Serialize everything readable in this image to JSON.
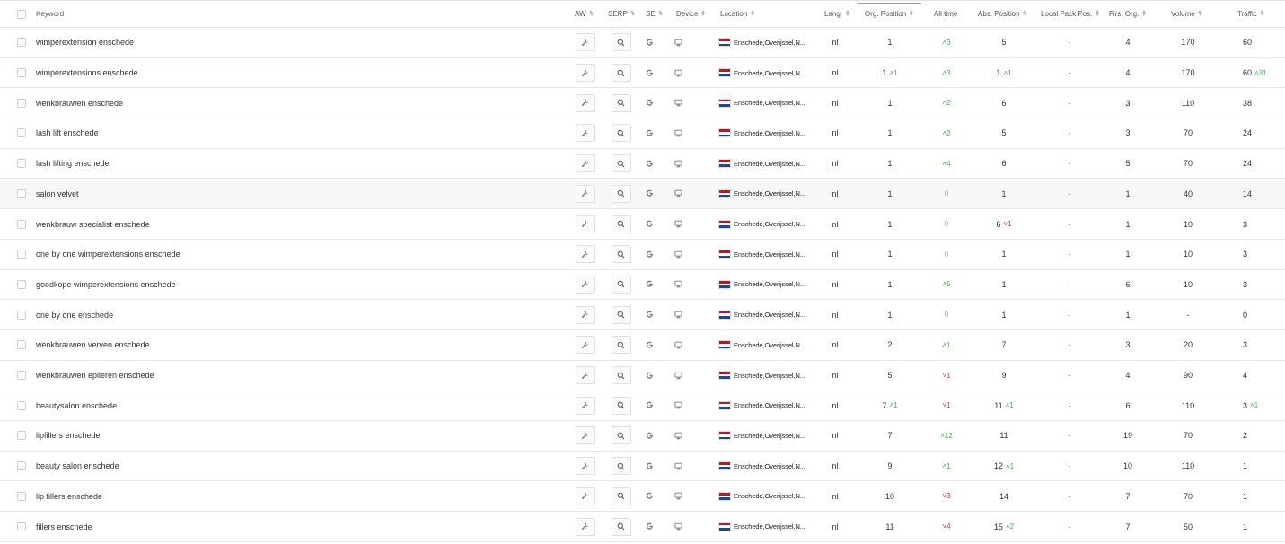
{
  "columns": {
    "keyword": "Keyword",
    "aw": "AW",
    "serp": "SERP",
    "se": "SE",
    "device": "Device",
    "location": "Location",
    "lang": "Lang.",
    "org_position": "Org. Position",
    "all_time": "All time",
    "abs_position": "Abs. Position",
    "local_pack": "Local Pack Pos.",
    "first_org": "First Org.",
    "volume": "Volume",
    "traffic": "Traffic"
  },
  "icons": {
    "aw": "wrench-icon",
    "serp": "magnifier-icon",
    "se": "google-g-icon",
    "device": "desktop-icon",
    "flag": "netherlands-flag-icon"
  },
  "colors": {
    "up": "#3cb54a",
    "down": "#d9363e",
    "flag_red": "#ae1c28",
    "flag_white": "#ffffff",
    "flag_blue": "#21468b"
  },
  "rows": [
    {
      "keyword": "wimperextension enschede",
      "location": "Enschede,Overijssel,N...",
      "lang": "nl",
      "org": "1",
      "org_chg": "",
      "org_dir": "",
      "all": "^3",
      "all_dir": "up",
      "abs": "5",
      "abs_chg": "",
      "abs_dir": "",
      "local": "-",
      "first": "4",
      "volume": "170",
      "traffic": "60",
      "traffic_chg": "",
      "traffic_dir": ""
    },
    {
      "keyword": "wimperextensions enschede",
      "location": "Enschede,Overijssel,N...",
      "lang": "nl",
      "org": "1",
      "org_chg": "^1",
      "org_dir": "up",
      "all": "^3",
      "all_dir": "up",
      "abs": "1",
      "abs_chg": "^1",
      "abs_dir": "up",
      "local": "-",
      "first": "4",
      "volume": "170",
      "traffic": "60",
      "traffic_chg": "^31",
      "traffic_dir": "up"
    },
    {
      "keyword": "wenkbrauwen enschede",
      "location": "Enschede,Overijssel,N...",
      "lang": "nl",
      "org": "1",
      "org_chg": "",
      "org_dir": "",
      "all": "^2",
      "all_dir": "up",
      "abs": "6",
      "abs_chg": "",
      "abs_dir": "",
      "local": "-",
      "first": "3",
      "volume": "110",
      "traffic": "38",
      "traffic_chg": "",
      "traffic_dir": ""
    },
    {
      "keyword": "lash lift enschede",
      "location": "Enschede,Overijssel,N...",
      "lang": "nl",
      "org": "1",
      "org_chg": "",
      "org_dir": "",
      "all": "^2",
      "all_dir": "up",
      "abs": "5",
      "abs_chg": "",
      "abs_dir": "",
      "local": "-",
      "first": "3",
      "volume": "70",
      "traffic": "24",
      "traffic_chg": "",
      "traffic_dir": ""
    },
    {
      "keyword": "lash lifting enschede",
      "location": "Enschede,Overijssel,N...",
      "lang": "nl",
      "org": "1",
      "org_chg": "",
      "org_dir": "",
      "all": "^4",
      "all_dir": "up",
      "abs": "6",
      "abs_chg": "",
      "abs_dir": "",
      "local": "-",
      "first": "5",
      "volume": "70",
      "traffic": "24",
      "traffic_chg": "",
      "traffic_dir": ""
    },
    {
      "keyword": "salon velvet",
      "location": "Enschede,Overijssel,N...",
      "lang": "nl",
      "org": "1",
      "org_chg": "",
      "org_dir": "",
      "all": "0",
      "all_dir": "zero",
      "abs": "1",
      "abs_chg": "",
      "abs_dir": "",
      "local": "-",
      "first": "1",
      "volume": "40",
      "traffic": "14",
      "traffic_chg": "",
      "traffic_dir": "",
      "highlight": true
    },
    {
      "keyword": "wenkbrauw specialist enschede",
      "location": "Enschede,Overijssel,N...",
      "lang": "nl",
      "org": "1",
      "org_chg": "",
      "org_dir": "",
      "all": "0",
      "all_dir": "zero",
      "abs": "6",
      "abs_chg": "v1",
      "abs_dir": "down",
      "local": "-",
      "first": "1",
      "volume": "10",
      "traffic": "3",
      "traffic_chg": "",
      "traffic_dir": ""
    },
    {
      "keyword": "one by one wimperextensions enschede",
      "location": "Enschede,Overijssel,N...",
      "lang": "nl",
      "org": "1",
      "org_chg": "",
      "org_dir": "",
      "all": "0",
      "all_dir": "zero",
      "abs": "1",
      "abs_chg": "",
      "abs_dir": "",
      "local": "-",
      "first": "1",
      "volume": "10",
      "traffic": "3",
      "traffic_chg": "",
      "traffic_dir": ""
    },
    {
      "keyword": "goedkope wimperextensions enschede",
      "location": "Enschede,Overijssel,N...",
      "lang": "nl",
      "org": "1",
      "org_chg": "",
      "org_dir": "",
      "all": "^5",
      "all_dir": "up",
      "abs": "1",
      "abs_chg": "",
      "abs_dir": "",
      "local": "-",
      "first": "6",
      "volume": "10",
      "traffic": "3",
      "traffic_chg": "",
      "traffic_dir": ""
    },
    {
      "keyword": "one by one enschede",
      "location": "Enschede,Overijssel,N...",
      "lang": "nl",
      "org": "1",
      "org_chg": "",
      "org_dir": "",
      "all": "0",
      "all_dir": "zero",
      "abs": "1",
      "abs_chg": "",
      "abs_dir": "",
      "local": "-",
      "first": "1",
      "volume": "-",
      "traffic": "0",
      "traffic_chg": "",
      "traffic_dir": ""
    },
    {
      "keyword": "wenkbrauwen verven enschede",
      "location": "Enschede,Overijssel,N...",
      "lang": "nl",
      "org": "2",
      "org_chg": "",
      "org_dir": "",
      "all": "^1",
      "all_dir": "up",
      "abs": "7",
      "abs_chg": "",
      "abs_dir": "",
      "local": "-",
      "first": "3",
      "volume": "20",
      "traffic": "3",
      "traffic_chg": "",
      "traffic_dir": ""
    },
    {
      "keyword": "wenkbrauwen epileren enschede",
      "location": "Enschede,Overijssel,N...",
      "lang": "nl",
      "org": "5",
      "org_chg": "",
      "org_dir": "",
      "all": "v1",
      "all_dir": "down",
      "abs": "9",
      "abs_chg": "",
      "abs_dir": "",
      "local": "-",
      "first": "4",
      "volume": "90",
      "traffic": "4",
      "traffic_chg": "",
      "traffic_dir": ""
    },
    {
      "keyword": "beautysalon enschede",
      "location": "Enschede,Overijssel,N...",
      "lang": "nl",
      "org": "7",
      "org_chg": "^1",
      "org_dir": "up",
      "all": "v1",
      "all_dir": "down",
      "abs": "11",
      "abs_chg": "^1",
      "abs_dir": "up",
      "local": "-",
      "first": "6",
      "volume": "110",
      "traffic": "3",
      "traffic_chg": "^1",
      "traffic_dir": "up"
    },
    {
      "keyword": "lipfillers enschede",
      "location": "Enschede,Overijssel,N...",
      "lang": "nl",
      "org": "7",
      "org_chg": "",
      "org_dir": "",
      "all": "^12",
      "all_dir": "up",
      "abs": "11",
      "abs_chg": "",
      "abs_dir": "",
      "local": "-",
      "first": "19",
      "volume": "70",
      "traffic": "2",
      "traffic_chg": "",
      "traffic_dir": ""
    },
    {
      "keyword": "beauty salon enschede",
      "location": "Enschede,Overijssel,N...",
      "lang": "nl",
      "org": "9",
      "org_chg": "",
      "org_dir": "",
      "all": "^1",
      "all_dir": "up",
      "abs": "12",
      "abs_chg": "^1",
      "abs_dir": "up",
      "local": "-",
      "first": "10",
      "volume": "110",
      "traffic": "1",
      "traffic_chg": "",
      "traffic_dir": ""
    },
    {
      "keyword": "lip fillers enschede",
      "location": "Enschede,Overijssel,N...",
      "lang": "nl",
      "org": "10",
      "org_chg": "",
      "org_dir": "",
      "all": "v3",
      "all_dir": "down",
      "abs": "14",
      "abs_chg": "",
      "abs_dir": "",
      "local": "-",
      "first": "7",
      "volume": "70",
      "traffic": "1",
      "traffic_chg": "",
      "traffic_dir": ""
    },
    {
      "keyword": "fillers enschede",
      "location": "Enschede,Overijssel,N...",
      "lang": "nl",
      "org": "11",
      "org_chg": "",
      "org_dir": "",
      "all": "v4",
      "all_dir": "down",
      "abs": "15",
      "abs_chg": "^2",
      "abs_dir": "up",
      "local": "-",
      "first": "7",
      "volume": "50",
      "traffic": "1",
      "traffic_chg": "",
      "traffic_dir": ""
    }
  ]
}
